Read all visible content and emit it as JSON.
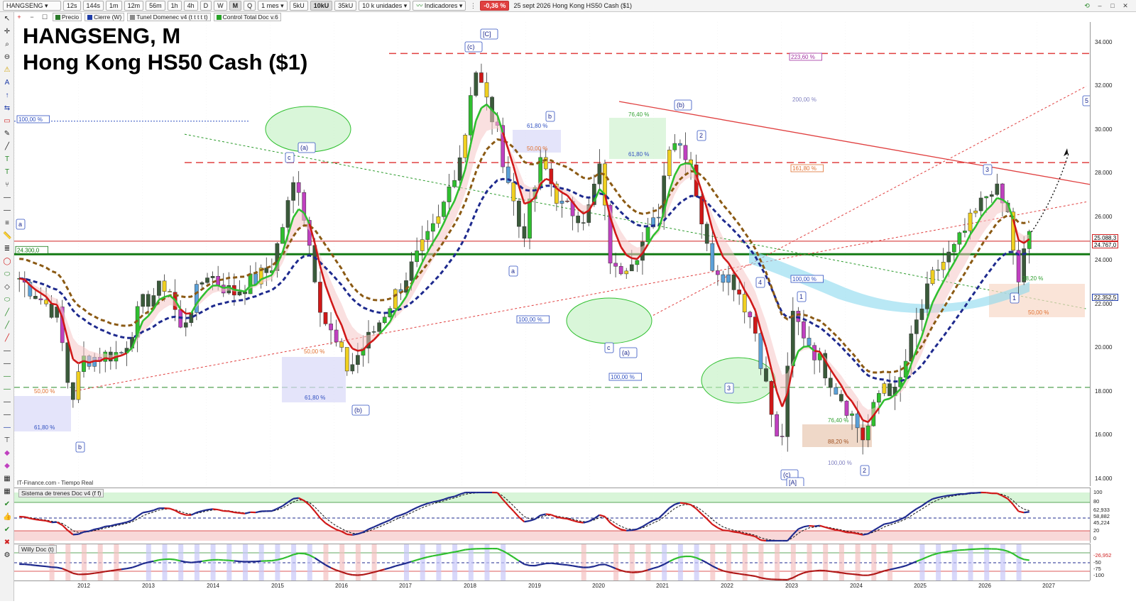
{
  "toolbar": {
    "symbol": "HANGSENG",
    "timeframes": [
      "12s",
      "144s",
      "1m",
      "12m",
      "56m",
      "1h",
      "4h",
      "D",
      "W",
      "M",
      "Q"
    ],
    "active_timeframe": "M",
    "period": "1 mes",
    "volume_buttons": [
      "5kU",
      "10kU",
      "35kU"
    ],
    "active_volume": "10kU",
    "units": "10 k unidades",
    "indicators_label": "Indicadores",
    "change": "-0,36 %",
    "date_text": "25 sept 2026  Hong Kong HS50 Cash ($1)"
  },
  "indicator_bar": {
    "items": [
      {
        "label": "Precio",
        "color": "#2a7a2a"
      },
      {
        "label": "Cierre (W)",
        "color": "#1e3ca8"
      },
      {
        "label": "Tunel Domenec v4 (t t t t t)",
        "color": "#8a8a8a"
      },
      {
        "label": "Control Total Doc v.6",
        "color": "#27a327"
      }
    ]
  },
  "chart": {
    "title_line1": "HANGSENG, M",
    "title_line2": "Hong Kong HS50 Cash ($1)",
    "feed_label": "IT-Finance.com - Tiempo Real",
    "price_ticks": [
      "34.000",
      "32.000",
      "30.000",
      "28.000",
      "26.000",
      "24.000",
      "22.000",
      "20.000",
      "18.000",
      "16.000",
      "14.000"
    ],
    "price_flags": [
      {
        "text": "25.088,3",
        "color": "#d02020"
      },
      {
        "text": "24.767,0",
        "color": "#d02020"
      },
      {
        "text": "22.352,5",
        "color": "#1e3ca8"
      }
    ],
    "left_level_label": "24.300,0",
    "fib_labels": {
      "f1000_left": "100,00 %",
      "f618_left": "61,80 %",
      "f50_left": "50,00 %",
      "f50_2016": "50,00 %",
      "f618_2016": "61,80 %",
      "f618_2018": "61,80 %",
      "f50_2018": "50,00 %",
      "f764_2020": "76,40 %",
      "f618_2020": "61,80 %",
      "f1000_2020": "100,00 %",
      "f1000_2022": "100,00 %",
      "f2236": "223,60 %",
      "f2000": "200,00 %",
      "f1618": "161,80 %",
      "f1000_2023": "100,00 %",
      "f764_2023": "76,40 %",
      "f882_2023": "88,20 %",
      "f1000b_2023": "100,00 %",
      "f382_2026": "38,20 %",
      "f50_2026": "50,00 %"
    },
    "wave_labels": [
      "[C]",
      "(c)",
      "b",
      "(b)",
      "2",
      "c",
      "(a)",
      "a",
      "a",
      "b",
      "(b)",
      "3",
      "c",
      "(a)",
      "1",
      "4",
      "3",
      "(c)",
      "[A]",
      "2",
      "5",
      "1",
      "3"
    ]
  },
  "panels": {
    "trenes_title": "Sistema de trenes Doc v4 (f f)",
    "trenes_ticks": [
      "100",
      "80",
      "62,933",
      "58,882",
      "45,224",
      "20",
      "0"
    ],
    "willy_title": "Willy Doc (t)",
    "willy_ticks": [
      "-26,952",
      "-50",
      "-75",
      "-100"
    ]
  },
  "time_axis": [
    "2012",
    "2013",
    "2014",
    "2015",
    "2016",
    "2017",
    "2018",
    "2019",
    "2020",
    "2021",
    "2022",
    "2023",
    "2024",
    "2025",
    "2026",
    "2027"
  ],
  "chart_data": {
    "type": "candlestick",
    "interval": "monthly",
    "ylim": [
      13500,
      35000
    ],
    "yearly_approx_close": {
      "x": [
        "2012",
        "2013",
        "2014",
        "2015",
        "2016",
        "2017",
        "2018",
        "2019",
        "2020",
        "2021",
        "2022",
        "2023",
        "2024",
        "2025",
        "2026"
      ],
      "values": [
        18000,
        22500,
        23500,
        22000,
        21500,
        25500,
        33000,
        26500,
        27500,
        23500,
        21000,
        17500,
        16500,
        20500,
        25000
      ]
    },
    "key_levels": [
      24300,
      28500,
      33500
    ],
    "last_price": 24767
  },
  "colors": {
    "green_line": "#2fbf2f",
    "red_line": "#d01818",
    "blue_dash": "#1e2a8e",
    "brown_dash": "#8b5a14",
    "support": "#137a13"
  }
}
